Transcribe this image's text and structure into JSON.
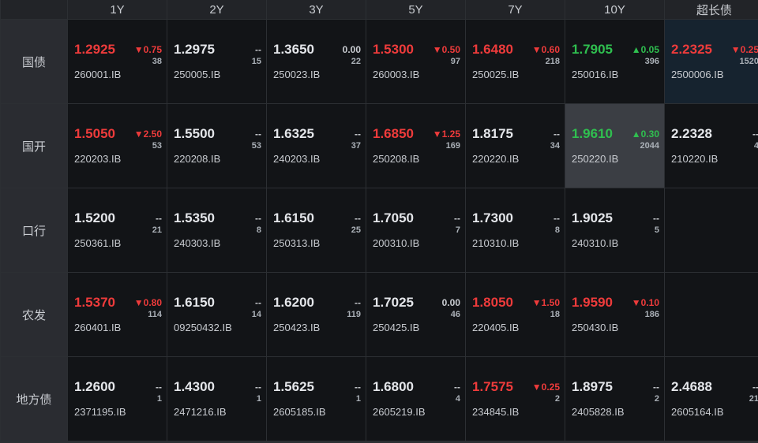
{
  "columns": [
    "1Y",
    "2Y",
    "3Y",
    "5Y",
    "7Y",
    "10Y",
    "超长债"
  ],
  "rows": [
    {
      "label": "国债",
      "cells": [
        {
          "yield": "1.2925",
          "change": "▼0.75",
          "volume": "38",
          "code": "260001.IB",
          "tone": "red"
        },
        {
          "yield": "1.2975",
          "change": "--",
          "volume": "15",
          "code": "250005.IB",
          "tone": "neutral"
        },
        {
          "yield": "1.3650",
          "change": "0.00",
          "volume": "22",
          "code": "250023.IB",
          "tone": "neutral"
        },
        {
          "yield": "1.5300",
          "change": "▼0.50",
          "volume": "97",
          "code": "260003.IB",
          "tone": "red"
        },
        {
          "yield": "1.6480",
          "change": "▼0.60",
          "volume": "218",
          "code": "250025.IB",
          "tone": "red"
        },
        {
          "yield": "1.7905",
          "change": "▲0.05",
          "volume": "396",
          "code": "250016.IB",
          "tone": "green"
        },
        {
          "yield": "2.2325",
          "change": "▼0.25",
          "volume": "1520",
          "code": "2500006.IB",
          "tone": "red",
          "highlight": "dark"
        }
      ]
    },
    {
      "label": "国开",
      "cells": [
        {
          "yield": "1.5050",
          "change": "▼2.50",
          "volume": "53",
          "code": "220203.IB",
          "tone": "red"
        },
        {
          "yield": "1.5500",
          "change": "--",
          "volume": "53",
          "code": "220208.IB",
          "tone": "neutral"
        },
        {
          "yield": "1.6325",
          "change": "--",
          "volume": "37",
          "code": "240203.IB",
          "tone": "neutral"
        },
        {
          "yield": "1.6850",
          "change": "▼1.25",
          "volume": "169",
          "code": "250208.IB",
          "tone": "red"
        },
        {
          "yield": "1.8175",
          "change": "--",
          "volume": "34",
          "code": "220220.IB",
          "tone": "neutral"
        },
        {
          "yield": "1.9610",
          "change": "▲0.30",
          "volume": "2044",
          "code": "250220.IB",
          "tone": "green",
          "highlight": "gray"
        },
        {
          "yield": "2.2328",
          "change": "--",
          "volume": "4",
          "code": "210220.IB",
          "tone": "neutral"
        }
      ]
    },
    {
      "label": "口行",
      "cells": [
        {
          "yield": "1.5200",
          "change": "--",
          "volume": "21",
          "code": "250361.IB",
          "tone": "neutral"
        },
        {
          "yield": "1.5350",
          "change": "--",
          "volume": "8",
          "code": "240303.IB",
          "tone": "neutral"
        },
        {
          "yield": "1.6150",
          "change": "--",
          "volume": "25",
          "code": "250313.IB",
          "tone": "neutral"
        },
        {
          "yield": "1.7050",
          "change": "--",
          "volume": "7",
          "code": "200310.IB",
          "tone": "neutral"
        },
        {
          "yield": "1.7300",
          "change": "--",
          "volume": "8",
          "code": "210310.IB",
          "tone": "neutral"
        },
        {
          "yield": "1.9025",
          "change": "--",
          "volume": "5",
          "code": "240310.IB",
          "tone": "neutral"
        },
        null
      ]
    },
    {
      "label": "农发",
      "cells": [
        {
          "yield": "1.5370",
          "change": "▼0.80",
          "volume": "114",
          "code": "260401.IB",
          "tone": "red"
        },
        {
          "yield": "1.6150",
          "change": "--",
          "volume": "14",
          "code": "09250432.IB",
          "tone": "neutral"
        },
        {
          "yield": "1.6200",
          "change": "--",
          "volume": "119",
          "code": "250423.IB",
          "tone": "neutral"
        },
        {
          "yield": "1.7025",
          "change": "0.00",
          "volume": "46",
          "code": "250425.IB",
          "tone": "neutral"
        },
        {
          "yield": "1.8050",
          "change": "▼1.50",
          "volume": "18",
          "code": "220405.IB",
          "tone": "red"
        },
        {
          "yield": "1.9590",
          "change": "▼0.10",
          "volume": "186",
          "code": "250430.IB",
          "tone": "red"
        },
        null
      ]
    },
    {
      "label": "地方债",
      "cells": [
        {
          "yield": "1.2600",
          "change": "--",
          "volume": "1",
          "code": "2371195.IB",
          "tone": "neutral"
        },
        {
          "yield": "1.4300",
          "change": "--",
          "volume": "1",
          "code": "2471216.IB",
          "tone": "neutral"
        },
        {
          "yield": "1.5625",
          "change": "--",
          "volume": "1",
          "code": "2605185.IB",
          "tone": "neutral"
        },
        {
          "yield": "1.6800",
          "change": "--",
          "volume": "4",
          "code": "2605219.IB",
          "tone": "neutral"
        },
        {
          "yield": "1.7575",
          "change": "▼0.25",
          "volume": "2",
          "code": "234845.IB",
          "tone": "red"
        },
        {
          "yield": "1.8975",
          "change": "--",
          "volume": "2",
          "code": "2405828.IB",
          "tone": "neutral"
        },
        {
          "yield": "2.4688",
          "change": "--",
          "volume": "21",
          "code": "2605164.IB",
          "tone": "neutral"
        }
      ]
    }
  ],
  "colors": {
    "down": "#ee3b3b",
    "up": "#2fbf4f",
    "neutral": "#e4e6ea"
  }
}
